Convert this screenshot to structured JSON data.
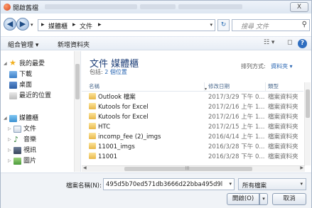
{
  "window": {
    "title": "開啟舊檔",
    "close_label": "X"
  },
  "address": {
    "back": "◀",
    "forward": "▶",
    "nav_dropdown": "▾",
    "crumbs": [
      "▸",
      "媒體櫃",
      "▸",
      "文件",
      "▸"
    ],
    "dropdown": "▾",
    "refresh": "↻",
    "search_placeholder": "搜尋 文件",
    "search_icon": "search-icon"
  },
  "toolbar": {
    "organize": "組合管理 ▾",
    "new_folder": "新增資料夾",
    "view": "☷ ▾",
    "pane": "◻",
    "help": "?"
  },
  "nav": {
    "items": [
      {
        "label": "我的最愛",
        "icon": "star-icon",
        "tri": "◢"
      },
      {
        "label": "下載",
        "icon": "download-folder-icon"
      },
      {
        "label": "桌面",
        "icon": "desktop-icon"
      },
      {
        "label": "最近的位置",
        "icon": "recent-places-icon"
      },
      {
        "label": "媒體櫃",
        "icon": "library-icon",
        "tri": "◢"
      },
      {
        "label": "文件",
        "icon": "documents-icon",
        "tri": "▷"
      },
      {
        "label": "音樂",
        "icon": "music-icon",
        "tri": "▷"
      },
      {
        "label": "視訊",
        "icon": "video-icon",
        "tri": "▷"
      },
      {
        "label": "圖片",
        "icon": "pictures-icon",
        "tri": "▷"
      }
    ]
  },
  "library": {
    "title": "文件 媒體櫃",
    "includes_prefix": "包括: ",
    "includes_link": "2 個位置",
    "arrange_label": "排列方式:",
    "arrange_value": "資料夾 ▾"
  },
  "columns": {
    "name": "名稱",
    "date": "修改日期",
    "type": "類型"
  },
  "files": [
    {
      "name": "Outlook 檔案",
      "date": "2017/3/29 下午 0...",
      "type": "檔案資料夾"
    },
    {
      "name": "Kutools for Excel",
      "date": "2017/2/16 上午 1...",
      "type": "檔案資料夾"
    },
    {
      "name": "Kutools for Excel",
      "date": "2017/2/16 上午 1...",
      "type": "檔案資料夾"
    },
    {
      "name": "HTC",
      "date": "2017/2/15 上午 1...",
      "type": "檔案資料夾"
    },
    {
      "name": "incomp_fee (2)_imgs",
      "date": "2016/4/14 上午 1...",
      "type": "檔案資料夾"
    },
    {
      "name": "11001_imgs",
      "date": "2016/3/28 下午 0...",
      "type": "檔案資料夾"
    },
    {
      "name": "11001",
      "date": "2016/3/28 下午 0...",
      "type": "檔案資料夾"
    }
  ],
  "bottom": {
    "filename_label": "檔案名稱(N):",
    "filename_value": "495d5b70ed571db3666d22bba495d9l",
    "filter_value": "所有檔案",
    "open_label": "開啟(O)",
    "open_split": "▾",
    "cancel_label": "取消"
  },
  "scroll": {
    "left": "◀",
    "right": "▶",
    "grip": "|||"
  }
}
